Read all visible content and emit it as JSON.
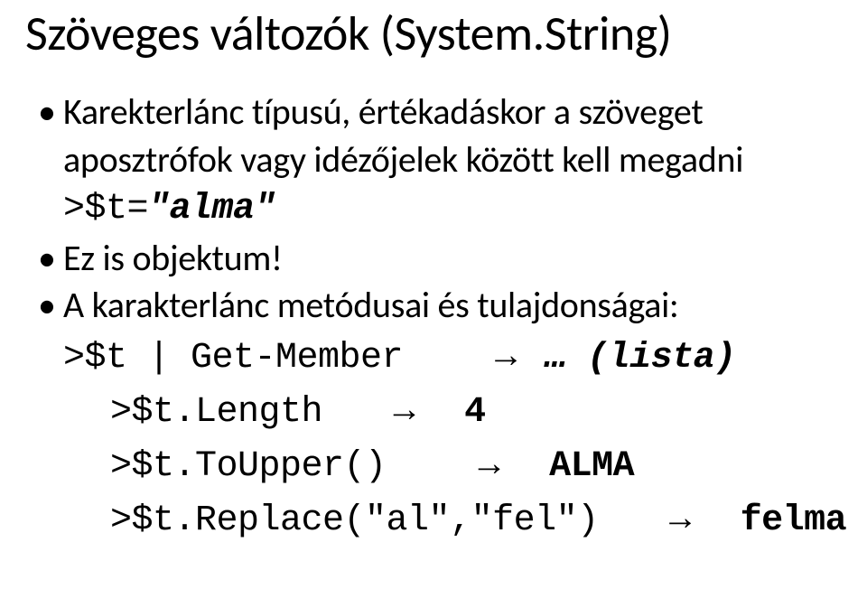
{
  "title": "Szöveges változók (System.String)",
  "bullets": {
    "b1": "Karekterlánc típusú, értékadáskor a szöveget aposztrófok vagy idézőjelek között kell megadni",
    "b2": "Ez is objektum!",
    "b3": "A karakterlánc metódusai és tulajdonságai:"
  },
  "code": {
    "assign_prefix": ">$t=",
    "assign_value": "\"alma\"",
    "getmember_prefix": ">$t | Get-Member",
    "getmember_arrow": "→",
    "getmember_result": "… (lista)",
    "length_prefix": ">$t.Length",
    "length_arrow": "→",
    "length_result": "4",
    "toupper_prefix": ">$t.ToUpper()",
    "toupper_arrow": "→",
    "toupper_result": "ALMA",
    "replace_prefix": ">$t.Replace(\"al\",\"fel\")",
    "replace_arrow": "→",
    "replace_result": "felma"
  },
  "chart_data": null
}
